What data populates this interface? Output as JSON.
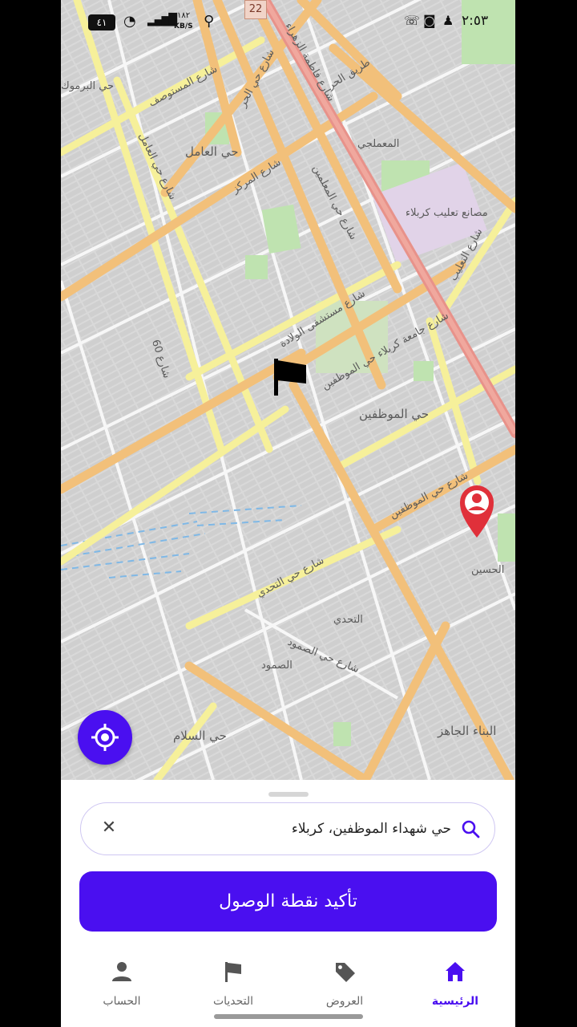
{
  "status_bar": {
    "time": "٢:٥٣",
    "battery": "٤١",
    "net_speed_value": "١٨٢",
    "net_speed_unit": "KB/S"
  },
  "map": {
    "route_badge": "22",
    "labels": [
      "حي العامل",
      "شارع المستوصف",
      "شارع حي الحر",
      "شارع فاطمة الزهراء",
      "طريق الحر",
      "المعملجي",
      "شارع حي العامل",
      "شارع المركز",
      "شارع حي المعلمين",
      "مصانع تعليب كربلاء",
      "شارع التعليب",
      "شارع 60",
      "شارع مستشفى الولادة",
      "شارع جامعة كربلاء حي الموظفين",
      "حي الموظفين",
      "شارع حي الموظفين",
      "الحسين",
      "شارع حي التحدي",
      "التحدي",
      "شارع حي الصمود",
      "الصمود",
      "حي السلام",
      "البناء الجاهز",
      "حي البرموك"
    ]
  },
  "search": {
    "value": "حي شهداء الموظفين، كربلاء",
    "clear_glyph": "✕"
  },
  "confirm_button": {
    "label": "تأكيد نقطة الوصول"
  },
  "nav": [
    {
      "label": "الرئيسية",
      "icon": "home-icon",
      "active": true
    },
    {
      "label": "العروض",
      "icon": "tag-icon",
      "active": false
    },
    {
      "label": "التحديات",
      "icon": "flag-icon",
      "active": false
    },
    {
      "label": "الحساب",
      "icon": "person-icon",
      "active": false
    }
  ],
  "colors": {
    "accent": "#4a0ff0",
    "main_road": "#f2c07a",
    "highway": "#e8928a",
    "secondary_road": "#f6f09a",
    "marker_red": "#e0303a"
  }
}
